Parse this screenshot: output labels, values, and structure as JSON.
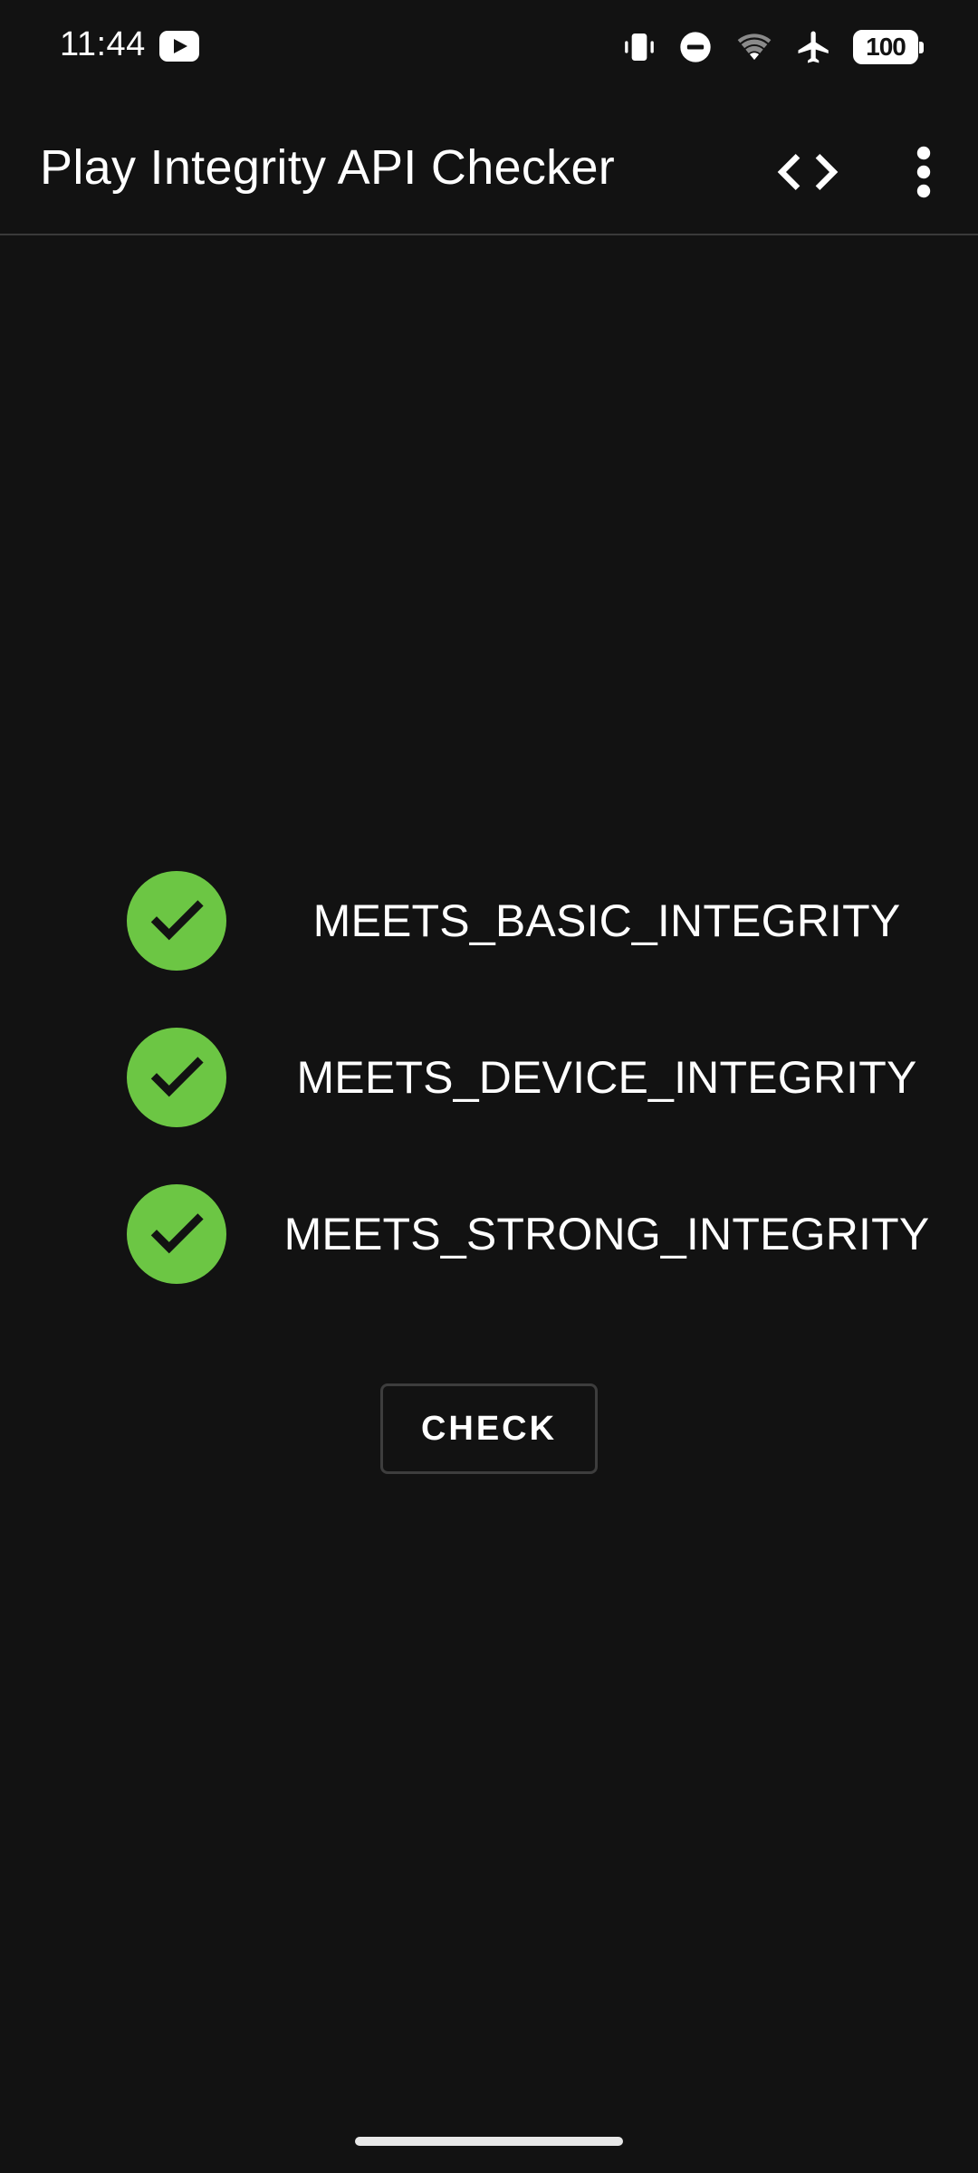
{
  "status_bar": {
    "time": "11:44",
    "battery": "100",
    "icons": [
      "youtube-icon",
      "vibrate-icon",
      "dnd-icon",
      "wifi-icon",
      "airplane-icon",
      "battery-icon"
    ]
  },
  "toolbar": {
    "title": "Play Integrity API Checker",
    "icons": [
      "code-icon",
      "more-vert-icon"
    ]
  },
  "checks": [
    {
      "label": "MEETS_BASIC_INTEGRITY",
      "status": "pass"
    },
    {
      "label": "MEETS_DEVICE_INTEGRITY",
      "status": "pass"
    },
    {
      "label": "MEETS_STRONG_INTEGRITY",
      "status": "pass"
    }
  ],
  "check_button": {
    "label": "CHECK"
  },
  "colors": {
    "background": "#121212",
    "pass_green": "#6cc644",
    "text": "#ffffff",
    "divider": "#3a3a3a"
  }
}
